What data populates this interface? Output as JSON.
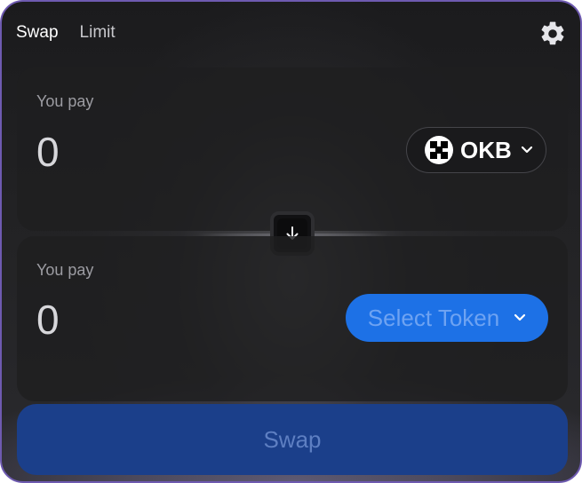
{
  "tabs": [
    {
      "label": "Swap",
      "active": true
    },
    {
      "label": "Limit",
      "active": false
    }
  ],
  "settings_icon": "gear-icon",
  "pay_panel": {
    "label": "You pay",
    "amount": "0",
    "token": {
      "symbol": "OKB",
      "icon": "okb-logo-icon"
    }
  },
  "flip_icon": "arrow-down-icon",
  "receive_panel": {
    "label": "You pay",
    "amount": "0",
    "select_label": "Select Token"
  },
  "submit": {
    "label": "Swap"
  },
  "colors": {
    "accent": "#1d71e6",
    "submit_bg": "#1b3f8a",
    "border": "#6e5ab0"
  }
}
